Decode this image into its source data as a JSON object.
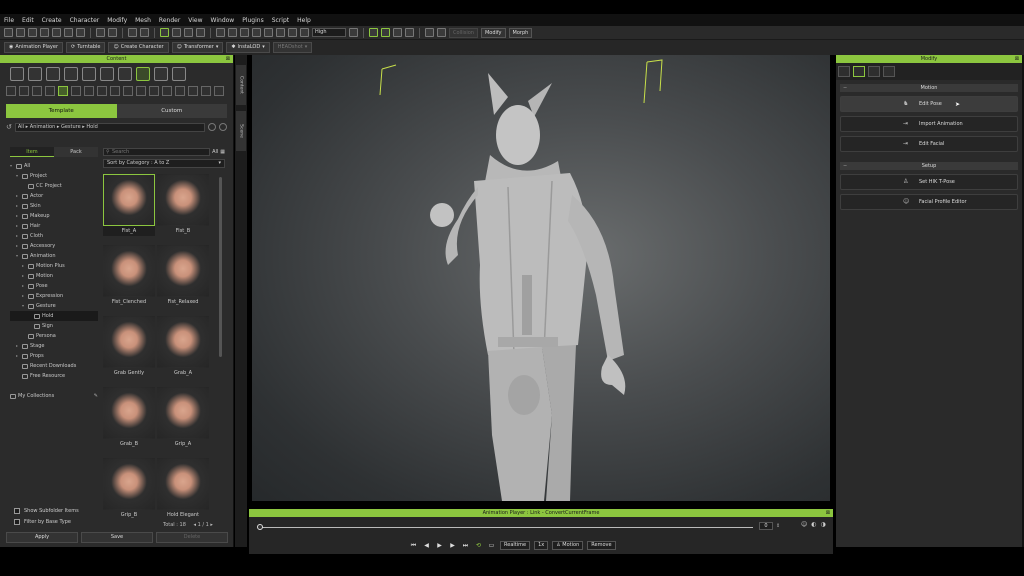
{
  "menu": [
    "File",
    "Edit",
    "Create",
    "Character",
    "Modify",
    "Mesh",
    "Render",
    "View",
    "Window",
    "Plugins",
    "Script",
    "Help"
  ],
  "toolbar1": {
    "quality": "High",
    "modify_label": "Modify",
    "morph_label": "Morph",
    "dim_label": "Collision"
  },
  "toolbar2": {
    "animation_player": "Animation Player",
    "turntable": "Turntable",
    "create_character": "Create Character",
    "transformer": "Transformer",
    "install": "InstaLOD",
    "dim_item": "HEADshot"
  },
  "content": {
    "title": "Content",
    "tabs": [
      "Template",
      "Custom"
    ],
    "breadcrumb": [
      "All",
      "Animation",
      "Gesture",
      "Hold"
    ],
    "item_pack_tabs": [
      "Item",
      "Pack"
    ],
    "search_placeholder": "Search",
    "search_scope": "All",
    "sort": "Sort by Category : A to Z",
    "tree": [
      {
        "label": "All",
        "level": 0,
        "twisty": "▾"
      },
      {
        "label": "Project",
        "level": 1,
        "twisty": "▾"
      },
      {
        "label": "CC Project",
        "level": 2,
        "twisty": ""
      },
      {
        "label": "Actor",
        "level": 1,
        "twisty": "▸"
      },
      {
        "label": "Skin",
        "level": 1,
        "twisty": "▸"
      },
      {
        "label": "Makeup",
        "level": 1,
        "twisty": "▸"
      },
      {
        "label": "Hair",
        "level": 1,
        "twisty": "▸"
      },
      {
        "label": "Cloth",
        "level": 1,
        "twisty": "▸"
      },
      {
        "label": "Accessory",
        "level": 1,
        "twisty": "▸"
      },
      {
        "label": "Animation",
        "level": 1,
        "twisty": "▾"
      },
      {
        "label": "Motion Plus",
        "level": 2,
        "twisty": "▸"
      },
      {
        "label": "Motion",
        "level": 2,
        "twisty": "▸"
      },
      {
        "label": "Pose",
        "level": 2,
        "twisty": "▸"
      },
      {
        "label": "Expression",
        "level": 2,
        "twisty": "▸"
      },
      {
        "label": "Gesture",
        "level": 2,
        "twisty": "▾"
      },
      {
        "label": "Hold",
        "level": 3,
        "twisty": "",
        "selected": true
      },
      {
        "label": "Sign",
        "level": 3,
        "twisty": ""
      },
      {
        "label": "Persona",
        "level": 2,
        "twisty": ""
      },
      {
        "label": "Stage",
        "level": 1,
        "twisty": "▸"
      },
      {
        "label": "Props",
        "level": 1,
        "twisty": "▸"
      },
      {
        "label": "Recent Downloads",
        "level": 1,
        "twisty": ""
      },
      {
        "label": "Free Resource",
        "level": 1,
        "twisty": ""
      }
    ],
    "collections": "My Collections",
    "thumbs": [
      "Fist_A",
      "Fist_B",
      "Fist_Clenched",
      "Fist_Relaxed",
      "Grab Gently",
      "Grab_A",
      "Grab_B",
      "Grip_A",
      "Grip_B",
      "Hold Elegant"
    ],
    "total": "Total : 18",
    "pager": "1 / 1",
    "show_subfolder": "Show Subfolder Items",
    "filter_base": "Filter by Base Type",
    "apply": "Apply",
    "save": "Save",
    "delete": "Delete"
  },
  "side_tabs": [
    "Content",
    "Scene"
  ],
  "anim": {
    "title": "Animation Player : Link - ConvertCurrentFrame",
    "frame": "0",
    "realtime": "Realtime",
    "speed": "1x",
    "motion": "Motion",
    "remove": "Remove"
  },
  "modify": {
    "title": "Modify",
    "motion_section": "Motion",
    "edit_pose": "Edit Pose",
    "import_animation": "Import Animation",
    "edit_facial": "Edit Facial",
    "setup_section": "Setup",
    "set_hik": "Set HIK T-Pose",
    "facial_profile": "Facial Profile Editor"
  },
  "colors": {
    "accent": "#8cc63f",
    "panel": "#2b2b2b"
  }
}
